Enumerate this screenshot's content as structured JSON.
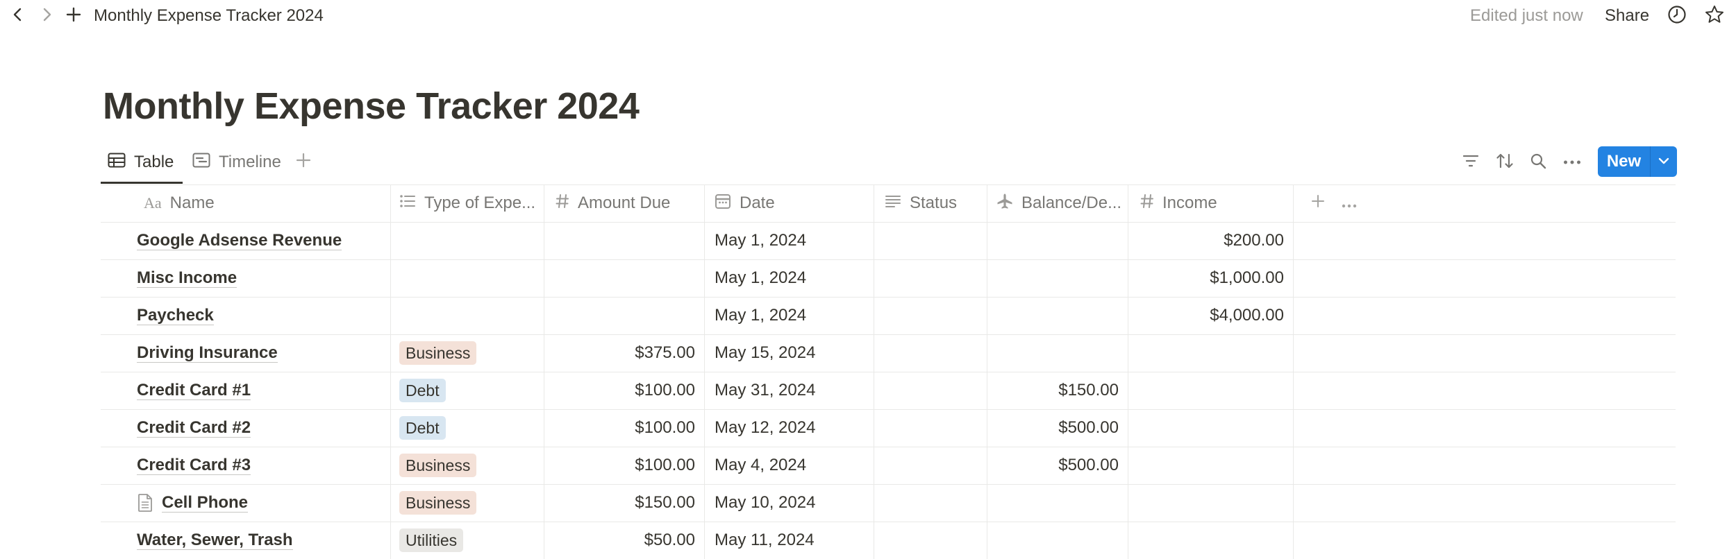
{
  "topbar": {
    "breadcrumb": "Monthly Expense Tracker 2024",
    "edited": "Edited just now",
    "share_label": "Share"
  },
  "page": {
    "title": "Monthly Expense Tracker 2024"
  },
  "views": {
    "tabs": [
      {
        "label": "Table",
        "icon": "table-icon",
        "active": true
      },
      {
        "label": "Timeline",
        "icon": "timeline-icon",
        "active": false
      }
    ],
    "new_label": "New"
  },
  "table": {
    "columns": [
      {
        "label": "Name",
        "icon": "text-aa-icon"
      },
      {
        "label": "Type of Expe...",
        "icon": "list-icon"
      },
      {
        "label": "Amount Due",
        "icon": "hash-icon"
      },
      {
        "label": "Date",
        "icon": "calendar-icon"
      },
      {
        "label": "Status",
        "icon": "text-lines-icon"
      },
      {
        "label": "Balance/De...",
        "icon": "plane-icon"
      },
      {
        "label": "Income",
        "icon": "hash-icon"
      }
    ],
    "rows": [
      {
        "name": "Google Adsense Revenue",
        "type": "",
        "amount": "",
        "date": "May 1, 2024",
        "status": "",
        "balance": "",
        "income": "$200.00"
      },
      {
        "name": "Misc Income",
        "type": "",
        "amount": "",
        "date": "May 1, 2024",
        "status": "",
        "balance": "",
        "income": "$1,000.00"
      },
      {
        "name": "Paycheck",
        "type": "",
        "amount": "",
        "date": "May 1, 2024",
        "status": "",
        "balance": "",
        "income": "$4,000.00"
      },
      {
        "name": "Driving Insurance",
        "type": "Business",
        "amount": "$375.00",
        "date": "May 15, 2024",
        "status": "",
        "balance": "",
        "income": ""
      },
      {
        "name": "Credit Card #1",
        "type": "Debt",
        "amount": "$100.00",
        "date": "May 31, 2024",
        "status": "",
        "balance": "$150.00",
        "income": ""
      },
      {
        "name": "Credit Card #2",
        "type": "Debt",
        "amount": "$100.00",
        "date": "May 12, 2024",
        "status": "",
        "balance": "$500.00",
        "income": ""
      },
      {
        "name": "Credit Card #3",
        "type": "Business",
        "amount": "$100.00",
        "date": "May 4, 2024",
        "status": "",
        "balance": "$500.00",
        "income": ""
      },
      {
        "name": "Cell Phone",
        "type": "Business",
        "amount": "$150.00",
        "date": "May 10, 2024",
        "status": "",
        "balance": "",
        "income": "",
        "page_icon": "document-icon"
      },
      {
        "name": "Water, Sewer, Trash",
        "type": "Utilities",
        "amount": "$50.00",
        "date": "May 11, 2024",
        "status": "",
        "balance": "",
        "income": ""
      }
    ]
  },
  "colors": {
    "accent": "#2383e2",
    "tag_business": "#f4e1d8",
    "tag_debt": "#d8e6f1",
    "tag_utilities": "#e9e8e5"
  }
}
